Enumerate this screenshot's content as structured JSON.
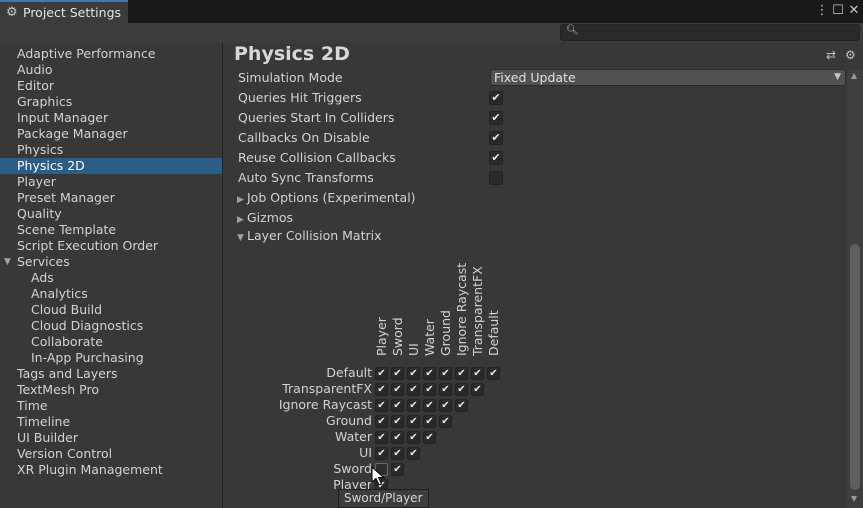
{
  "window": {
    "tab_title": "Project Settings",
    "menu_icon": "kebab-menu-icon",
    "maximize_icon": "maximize-icon",
    "close_icon": "close-icon"
  },
  "search": {
    "placeholder": "",
    "icon": "search-icon"
  },
  "sidebar": {
    "items": [
      {
        "label": "Adaptive Performance"
      },
      {
        "label": "Audio"
      },
      {
        "label": "Editor"
      },
      {
        "label": "Graphics"
      },
      {
        "label": "Input Manager"
      },
      {
        "label": "Package Manager"
      },
      {
        "label": "Physics"
      },
      {
        "label": "Physics 2D",
        "selected": true
      },
      {
        "label": "Player"
      },
      {
        "label": "Preset Manager"
      },
      {
        "label": "Quality"
      },
      {
        "label": "Scene Template"
      },
      {
        "label": "Script Execution Order"
      },
      {
        "label": "Services",
        "expanded": true
      },
      {
        "label": "Ads",
        "sub": true
      },
      {
        "label": "Analytics",
        "sub": true
      },
      {
        "label": "Cloud Build",
        "sub": true
      },
      {
        "label": "Cloud Diagnostics",
        "sub": true
      },
      {
        "label": "Collaborate",
        "sub": true
      },
      {
        "label": "In-App Purchasing",
        "sub": true
      },
      {
        "label": "Tags and Layers"
      },
      {
        "label": "TextMesh Pro"
      },
      {
        "label": "Time"
      },
      {
        "label": "Timeline"
      },
      {
        "label": "UI Builder"
      },
      {
        "label": "Version Control"
      },
      {
        "label": "XR Plugin Management"
      }
    ]
  },
  "main": {
    "title": "Physics 2D",
    "header_icons": [
      "settings-sliders-icon",
      "gear-icon"
    ],
    "simulation_mode": {
      "label": "Simulation Mode",
      "value": "Fixed Update"
    },
    "toggles": [
      {
        "label": "Queries Hit Triggers",
        "checked": true
      },
      {
        "label": "Queries Start In Colliders",
        "checked": true
      },
      {
        "label": "Callbacks On Disable",
        "checked": true
      },
      {
        "label": "Reuse Collision Callbacks",
        "checked": true
      },
      {
        "label": "Auto Sync Transforms",
        "checked": false
      }
    ],
    "foldouts": [
      {
        "label": "Job Options (Experimental)",
        "expanded": false
      },
      {
        "label": "Gizmos",
        "expanded": false
      },
      {
        "label": "Layer Collision Matrix",
        "expanded": true
      }
    ]
  },
  "matrix": {
    "columns": [
      "Player",
      "Sword",
      "UI",
      "Water",
      "Ground",
      "Ignore Raycast",
      "TransparentFX",
      "Default"
    ],
    "rows": [
      {
        "label": "Default",
        "cells": [
          true,
          true,
          true,
          true,
          true,
          true,
          true,
          true
        ]
      },
      {
        "label": "TransparentFX",
        "cells": [
          true,
          true,
          true,
          true,
          true,
          true,
          true
        ]
      },
      {
        "label": "Ignore Raycast",
        "cells": [
          true,
          true,
          true,
          true,
          true,
          true
        ]
      },
      {
        "label": "Ground",
        "cells": [
          true,
          true,
          true,
          true,
          true
        ]
      },
      {
        "label": "Water",
        "cells": [
          true,
          true,
          true,
          true
        ]
      },
      {
        "label": "UI",
        "cells": [
          true,
          true,
          true
        ]
      },
      {
        "label": "Sword",
        "cells": [
          false,
          true
        ]
      },
      {
        "label": "Player",
        "cells": [
          true
        ]
      }
    ],
    "tooltip": "Sword/Player"
  },
  "check_glyph": "✔"
}
